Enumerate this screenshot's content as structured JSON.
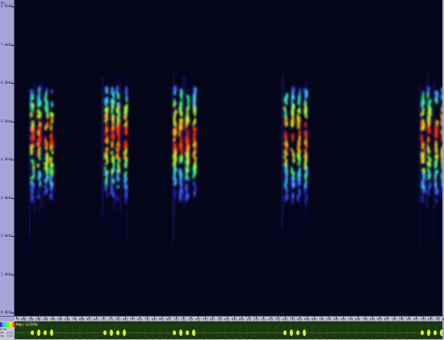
{
  "frequency_axis": {
    "top_label": "Hz: ...",
    "labels": [
      "8.0kHz",
      "7.0kHz",
      "6.0kHz",
      "5.0kHz",
      "4.0kHz",
      "3.0kHz",
      "2.0kHz",
      "1.0kHz",
      "0.0kHz"
    ]
  },
  "time_axis": {
    "labels": [
      "0.0s",
      "0.1s",
      "0.2s",
      "0.3s",
      "0.4s",
      "0.5s",
      "0.6s",
      "0.7s",
      "0.8s",
      "0.9s",
      "1.0s",
      "1.1s",
      "1.2s",
      "1.3s",
      "1.4s",
      "1.5s",
      "1.6s",
      "1.7s",
      "1.8s",
      "1.9s",
      "2.0s",
      "2.1s",
      "2.2s",
      "2.3s",
      "2.4s",
      "2.5s",
      "2.6s",
      "2.7s",
      "2.8s",
      "2.9s",
      "3.0s",
      "3.1s",
      "3.2s",
      "3.3s",
      "3.4s",
      "3.5s",
      "3.6s",
      "3.7s",
      "3.8s",
      "3.9s",
      "4.0s",
      "4.1s",
      "4.2s",
      "4.3s",
      "4.4s",
      "4.5s",
      "4.6s",
      "4.7s",
      "4.8s",
      "4.9s",
      "5.0s",
      "5.1s",
      "5.2s",
      "5.3s",
      "5.4s",
      "5.5s",
      "5.6s",
      "5.7s",
      "5.8s"
    ]
  },
  "waveform": {
    "header": "Amp: 1/1x5x",
    "side_labels": [
      "8170",
      "sm. 11111",
      "sm. 11111"
    ]
  },
  "colors": {
    "spectrogram_bg": "#05051a",
    "axis_bg": "#a4a4d8",
    "waveform_bg": "#1c3a10",
    "waveform_trace": "#d8f040"
  }
}
